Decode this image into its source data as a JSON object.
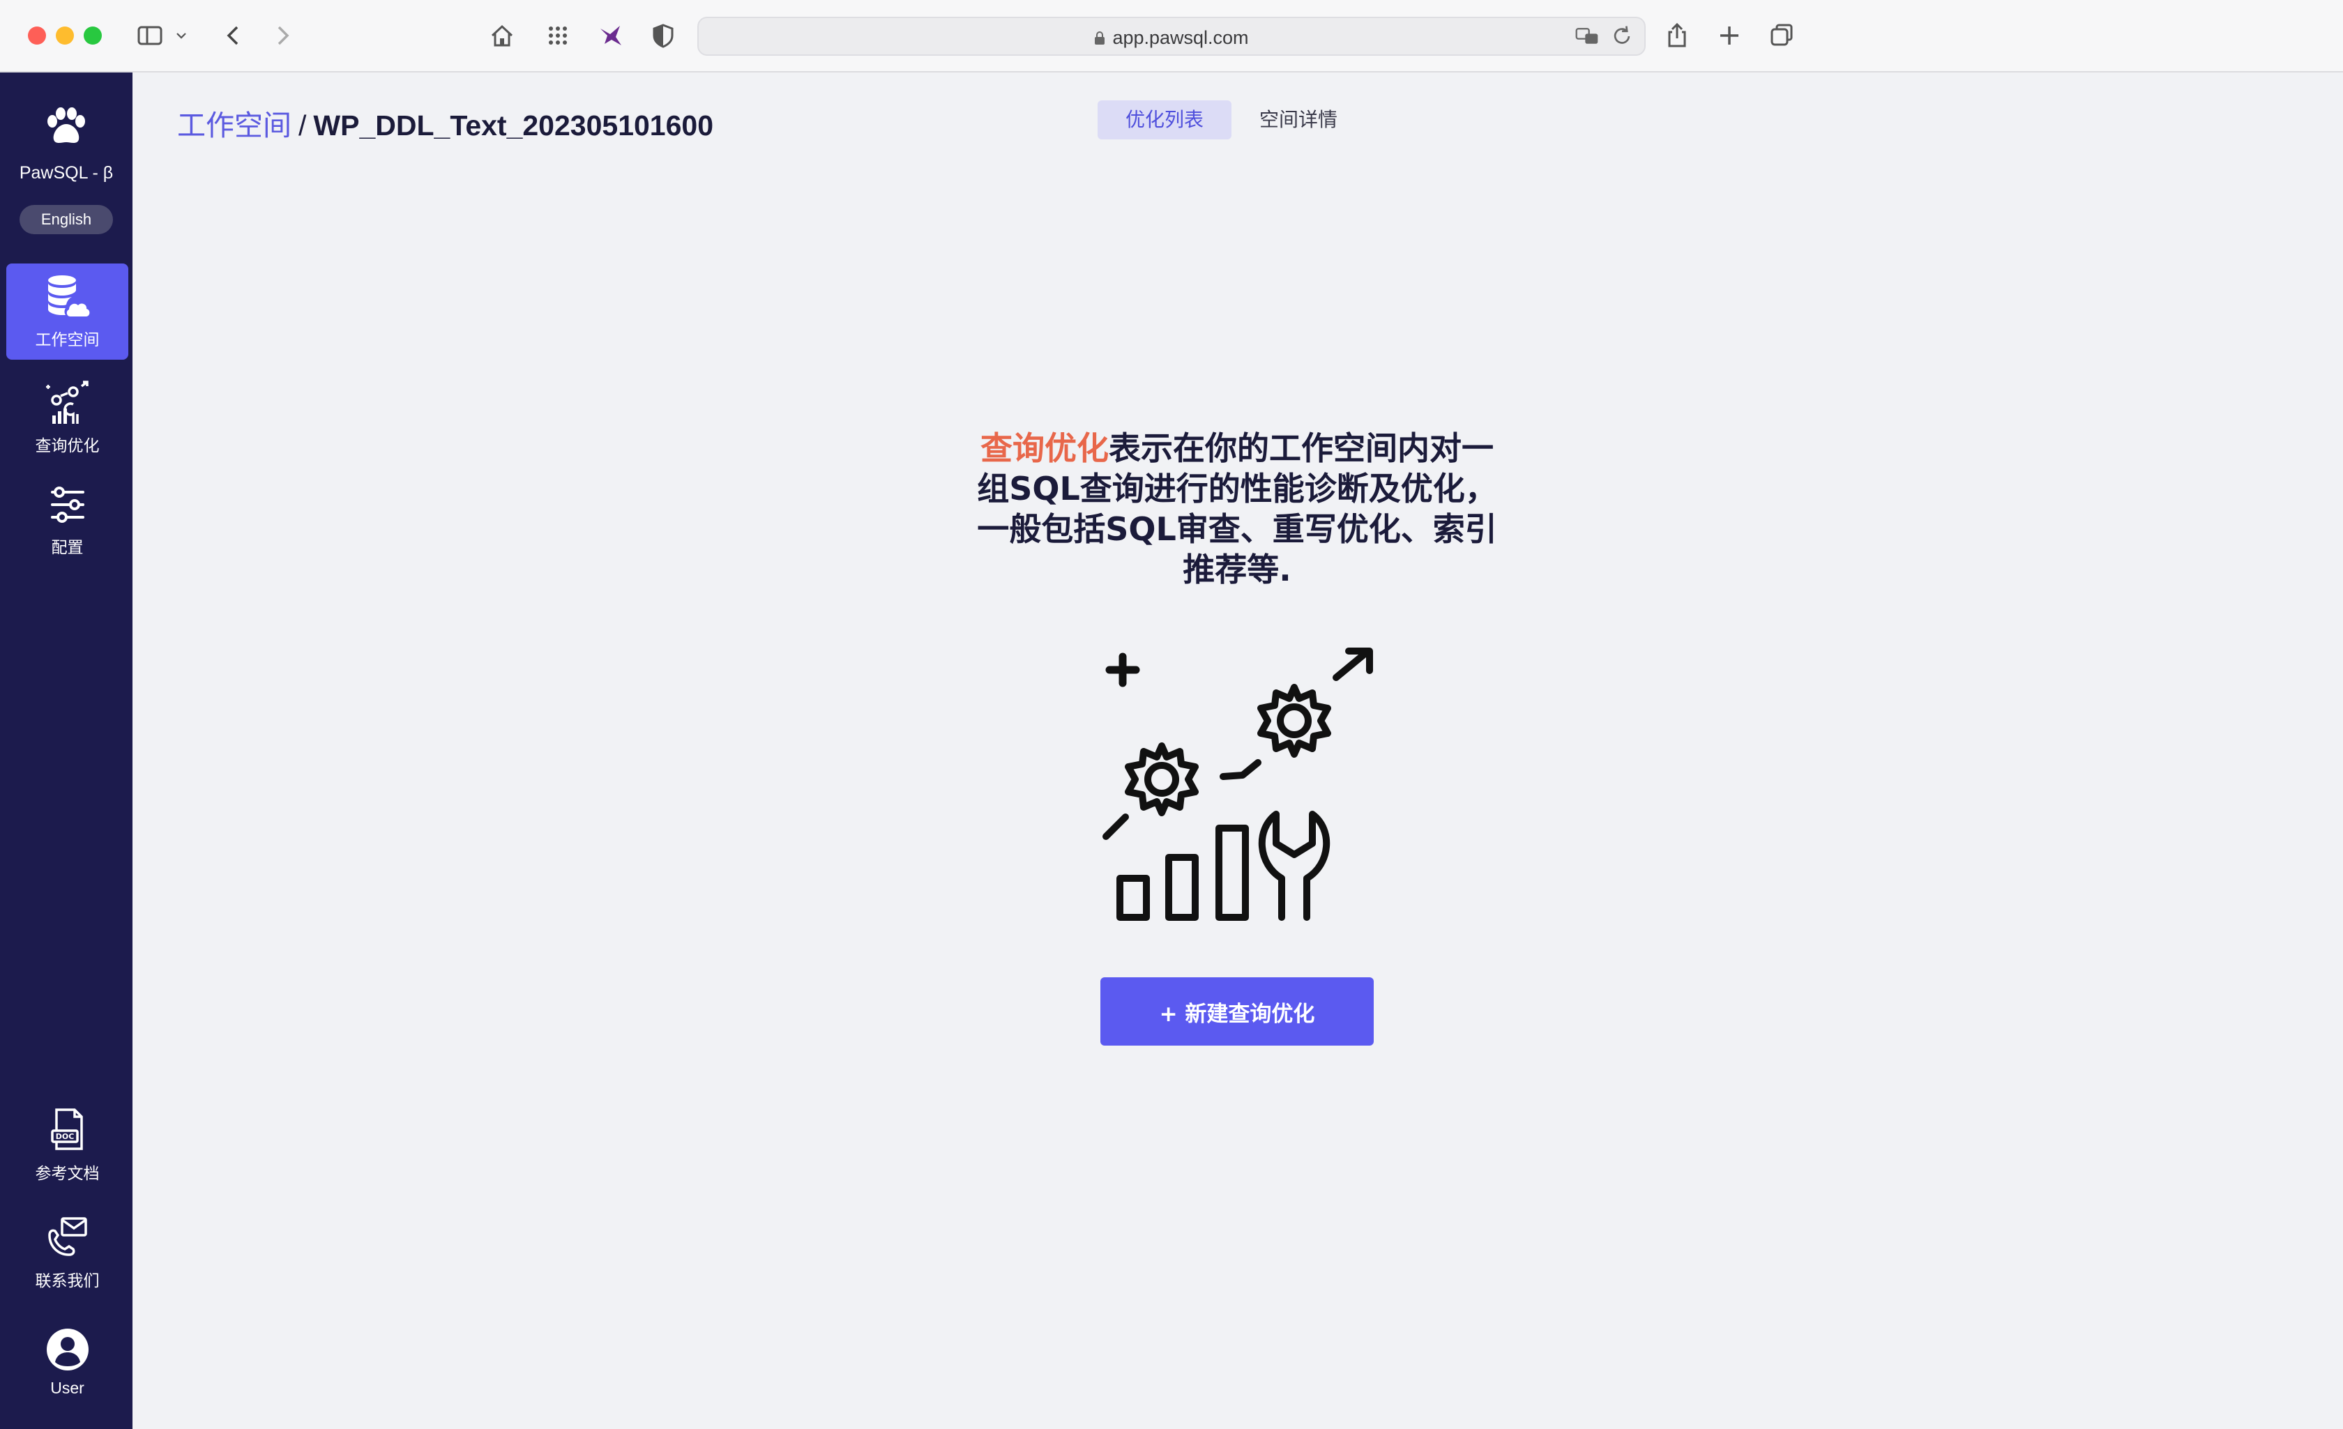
{
  "browser": {
    "url": "app.pawsql.com"
  },
  "sidebar": {
    "brand": "PawSQL - β",
    "language_button": "English",
    "items": [
      {
        "label": "工作空间",
        "icon": "database-cloud-icon",
        "active": true
      },
      {
        "label": "查询优化",
        "icon": "optimize-gears-icon",
        "active": false
      },
      {
        "label": "配置",
        "icon": "sliders-icon",
        "active": false
      }
    ],
    "bottom_items": [
      {
        "label": "参考文档",
        "icon": "doc-file-icon"
      },
      {
        "label": "联系我们",
        "icon": "contact-phone-icon"
      },
      {
        "label": "User",
        "icon": "user-avatar-icon"
      }
    ]
  },
  "breadcrumb": {
    "root": "工作空间",
    "separator": "/",
    "current": "WP_DDL_Text_202305101600"
  },
  "tabs": [
    {
      "label": "优化列表",
      "active": true
    },
    {
      "label": "空间详情",
      "active": false
    }
  ],
  "hero": {
    "highlight": "查询优化",
    "description": "表示在你的工作空间内对一组SQL查询进行的性能诊断及优化，一般包括SQL审查、重写优化、索引推荐等."
  },
  "actions": {
    "new_optimization": "+ 新建查询优化"
  },
  "colors": {
    "sidebar_bg": "#1c1b4d",
    "accent": "#5b5af0",
    "highlight": "#e8674a",
    "page_bg": "#f1f2f5"
  }
}
